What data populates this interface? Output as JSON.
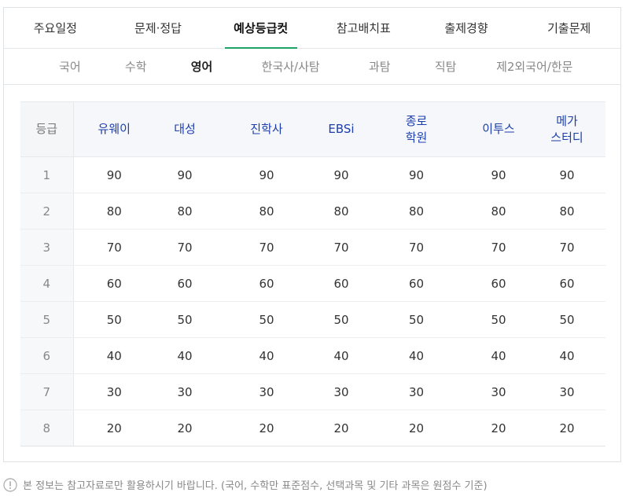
{
  "main_tabs": [
    {
      "label": "주요일정",
      "active": false
    },
    {
      "label": "문제·정답",
      "active": false
    },
    {
      "label": "예상등급컷",
      "active": true
    },
    {
      "label": "참고배치표",
      "active": false
    },
    {
      "label": "출제경향",
      "active": false
    },
    {
      "label": "기출문제",
      "active": false
    }
  ],
  "sub_tabs": [
    {
      "label": "국어",
      "active": false
    },
    {
      "label": "수학",
      "active": false
    },
    {
      "label": "영어",
      "active": true
    },
    {
      "label": "한국사/사탐",
      "active": false
    },
    {
      "label": "과탐",
      "active": false
    },
    {
      "label": "직탐",
      "active": false
    },
    {
      "label": "제2외국어/한문",
      "active": false
    }
  ],
  "table": {
    "grade_header": "등급",
    "providers": [
      {
        "line1": "유웨이",
        "line2": ""
      },
      {
        "line1": "대성",
        "line2": ""
      },
      {
        "line1": "진학사",
        "line2": ""
      },
      {
        "line1": "EBSi",
        "line2": ""
      },
      {
        "line1": "종로",
        "line2": "학원"
      },
      {
        "line1": "이투스",
        "line2": ""
      },
      {
        "line1": "메가",
        "line2": "스터디"
      }
    ],
    "rows": [
      {
        "grade": "1",
        "values": [
          "90",
          "90",
          "90",
          "90",
          "90",
          "90",
          "90"
        ]
      },
      {
        "grade": "2",
        "values": [
          "80",
          "80",
          "80",
          "80",
          "80",
          "80",
          "80"
        ]
      },
      {
        "grade": "3",
        "values": [
          "70",
          "70",
          "70",
          "70",
          "70",
          "70",
          "70"
        ]
      },
      {
        "grade": "4",
        "values": [
          "60",
          "60",
          "60",
          "60",
          "60",
          "60",
          "60"
        ]
      },
      {
        "grade": "5",
        "values": [
          "50",
          "50",
          "50",
          "50",
          "50",
          "50",
          "50"
        ]
      },
      {
        "grade": "6",
        "values": [
          "40",
          "40",
          "40",
          "40",
          "40",
          "40",
          "40"
        ]
      },
      {
        "grade": "7",
        "values": [
          "30",
          "30",
          "30",
          "30",
          "30",
          "30",
          "30"
        ]
      },
      {
        "grade": "8",
        "values": [
          "20",
          "20",
          "20",
          "20",
          "20",
          "20",
          "20"
        ]
      }
    ]
  },
  "notice": {
    "icon": "exclamation-circle-icon",
    "text": "본 정보는 참고자료로만 활용하시기 바랍니다. (국어, 수학만 표준점수, 선택과목 및 기타 과목은 원점수 기준)"
  },
  "colors": {
    "accent_green": "#1ea362",
    "provider_blue": "#1d3ea8",
    "header_bg": "#f5f7fb"
  }
}
